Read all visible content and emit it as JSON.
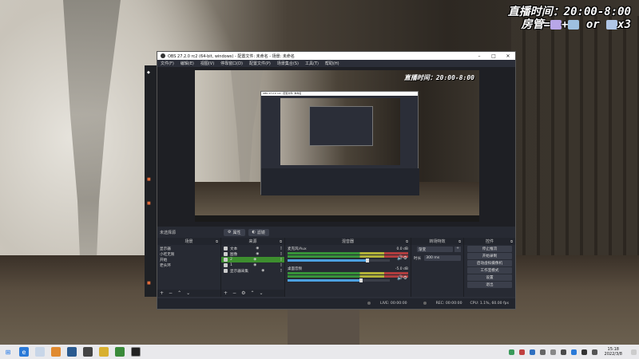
{
  "overlay": {
    "line1": "直播时间：20:00-8:00",
    "line2_prefix": "房管=",
    "line2_mid": "+",
    "line2_or": " or ",
    "line2_suffix": "x3"
  },
  "obs": {
    "title": "OBS 27.2.0 rc2 (64-bit, windows) - 配置文件: 未命名 - 场景: 未命名",
    "menu": [
      "文件(F)",
      "编辑(E)",
      "视图(V)",
      "停靠窗口(D)",
      "配置文件(P)",
      "场景集合(S)",
      "工具(T)",
      "帮助(H)"
    ],
    "preview_overlay": "直播时间：20:00-8:00",
    "nested_title": "OBS 27.2.0 rc2 - 配置文件: 未命名",
    "no_source": "未选择源",
    "props_button": "属性",
    "filters_button": "滤镜",
    "scenes": {
      "header": "场景",
      "items": [
        "显示器",
        "小吃无限",
        "开始",
        "老头环"
      ]
    },
    "sources": {
      "header": "来源",
      "items": [
        {
          "label": "文本"
        },
        {
          "label": "图像"
        },
        {
          "label": "2",
          "active": true
        },
        {
          "label": "1"
        },
        {
          "label": "显示器采集"
        }
      ]
    },
    "mixer": {
      "header": "混音器",
      "channels": [
        {
          "name": "麦克风/Aux",
          "db": "0.0 dB",
          "level": 0.78
        },
        {
          "name": "桌面音频",
          "db": "-5.0 dB",
          "level": 0.72
        }
      ]
    },
    "transitions": {
      "header": "转场特效",
      "fade_label": "渐变",
      "duration_label": "时长",
      "duration_value": "300 ms"
    },
    "controls": {
      "header": "控件",
      "buttons": [
        "停止推流",
        "开始录制",
        "启动虚拟摄像机",
        "工作室模式",
        "设置",
        "退出"
      ]
    },
    "status": {
      "live": "LIVE: 00:00:00",
      "rec": "REC: 00:00:00",
      "cpu": "CPU: 1.1%, 60.00 fps"
    }
  },
  "taskbar": {
    "time": "15:18",
    "date": "2022/3/8"
  },
  "colors": {
    "obs_bg": "#2b2e38",
    "active_source": "#3d8e2e",
    "taskbar": "#e9e9ec"
  }
}
